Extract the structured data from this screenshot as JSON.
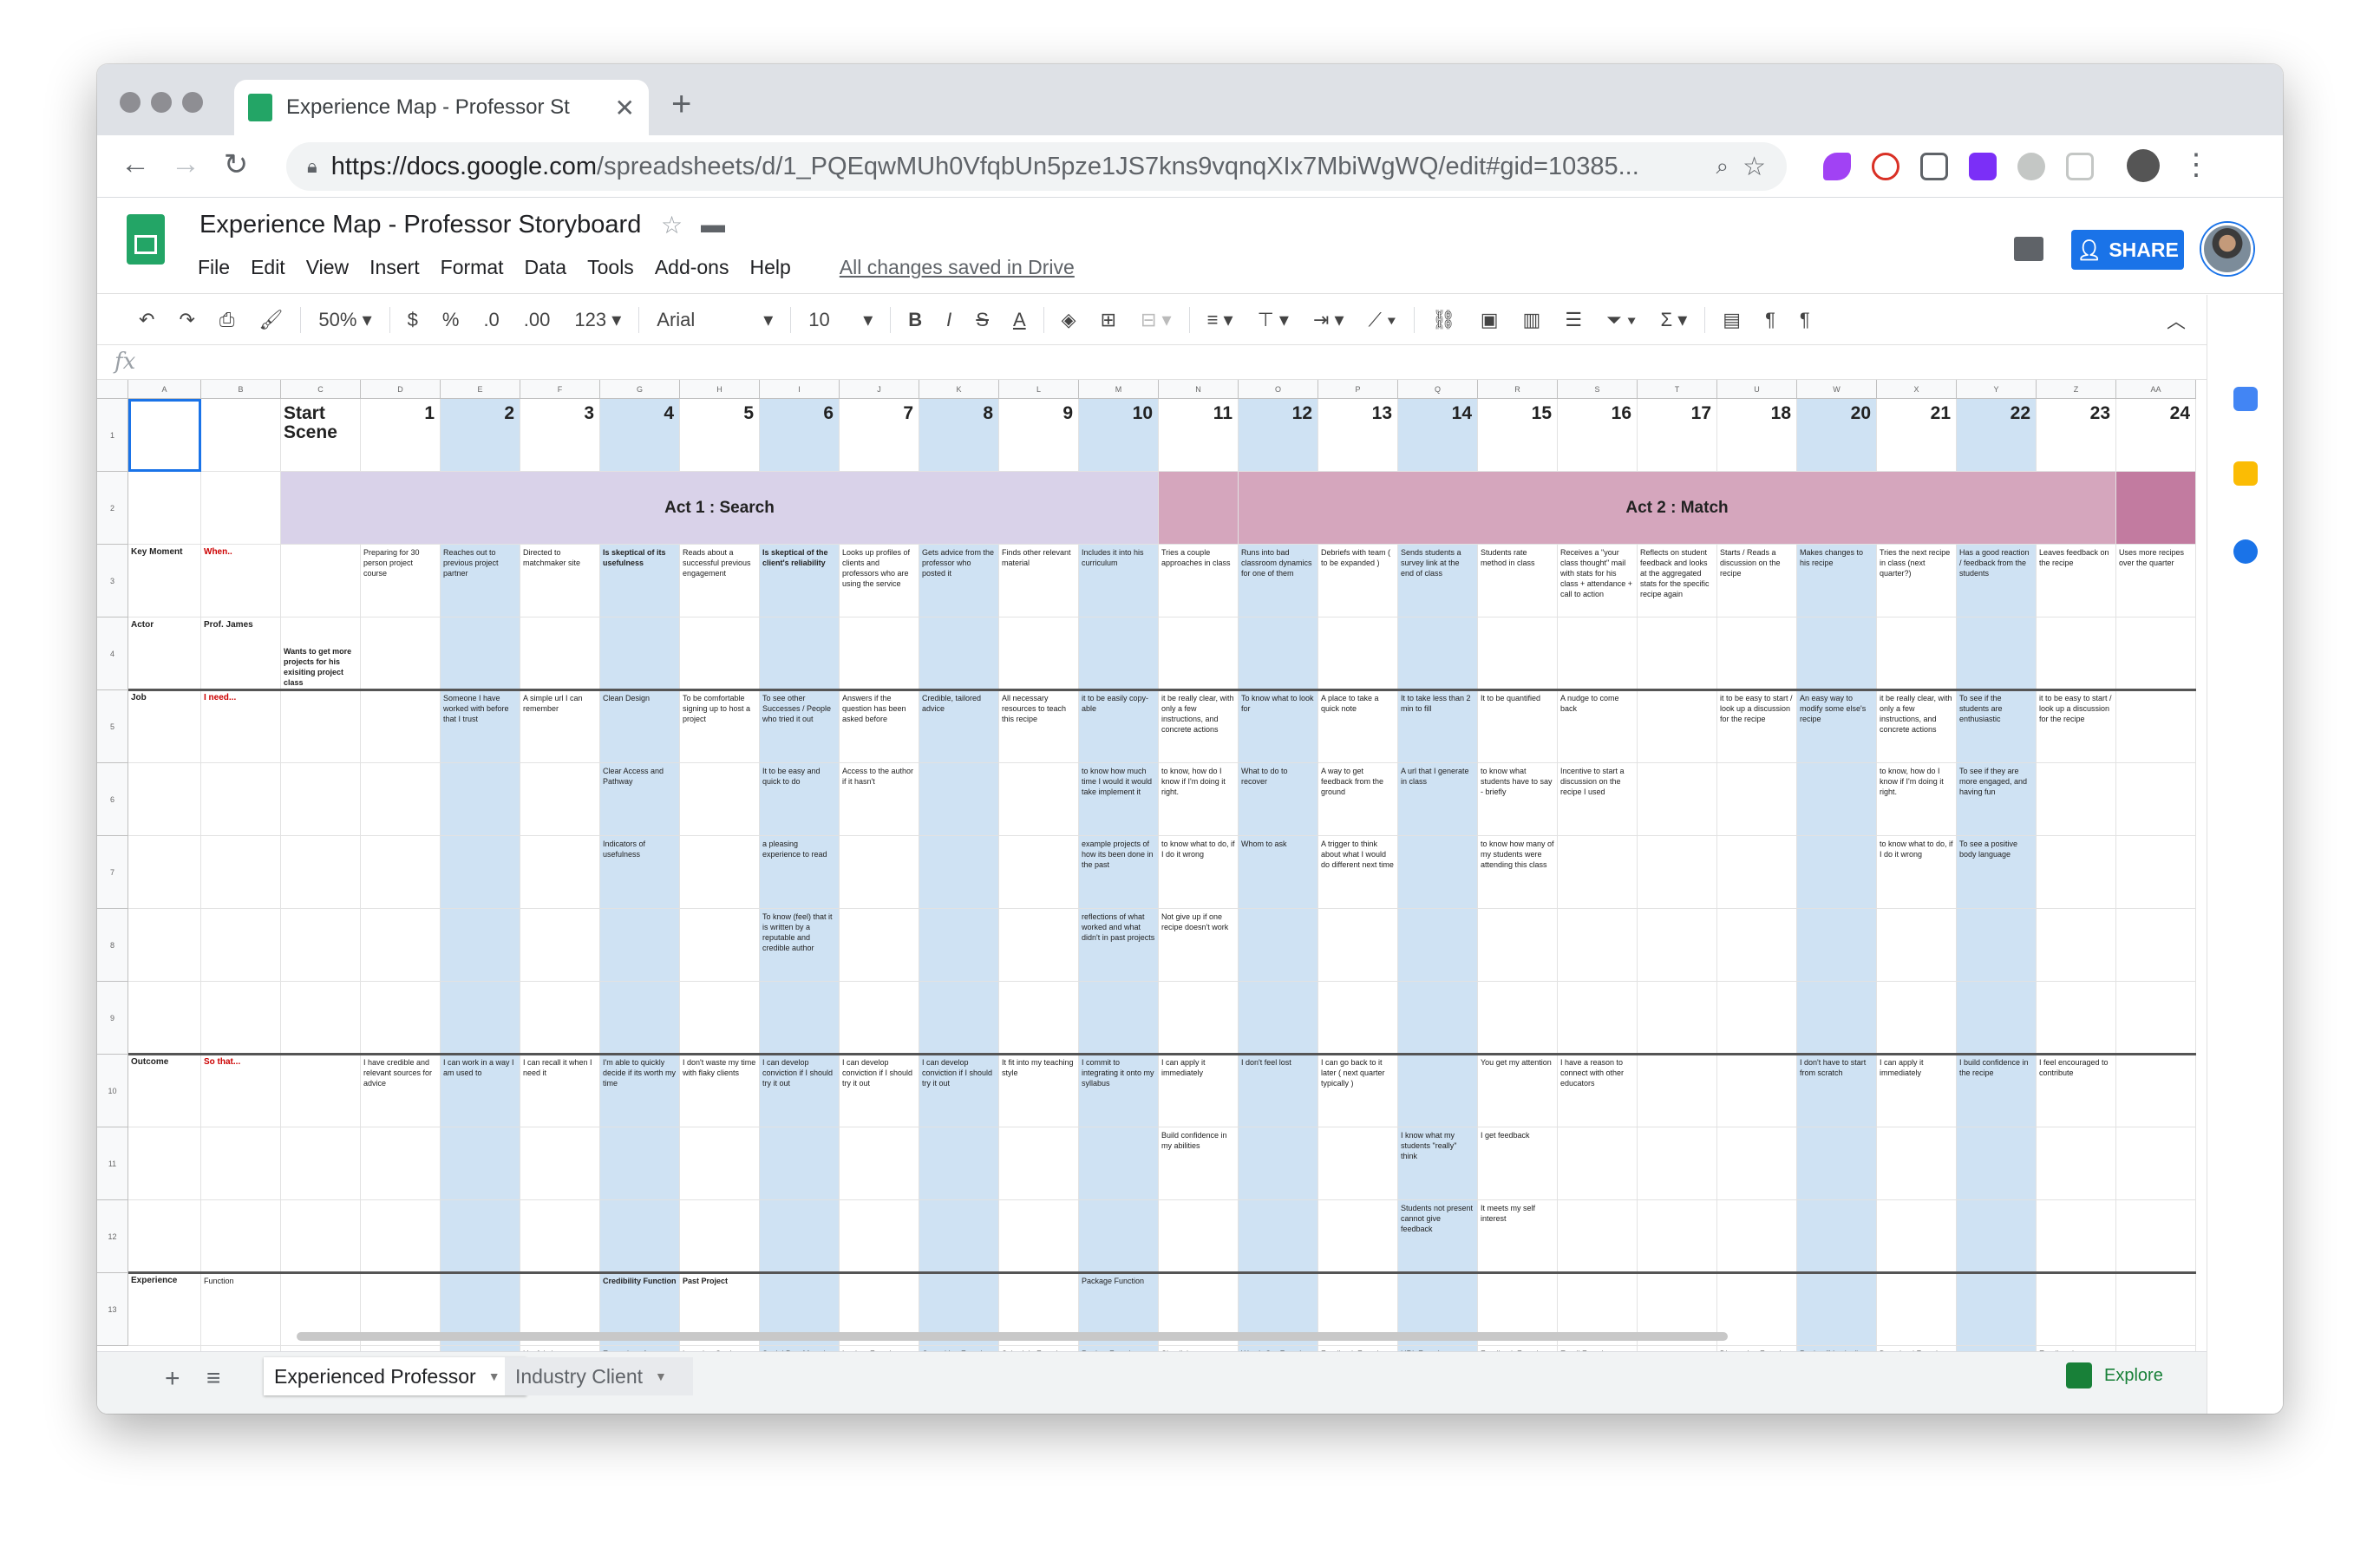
{
  "browser": {
    "tab_title": "Experience Map - Professor St",
    "url_host": "https://docs.google.com",
    "url_rest": "/spreadsheets/d/1_PQEqwMUh0VfqbUn5pze1JS7kns9vqnqXIx7MbiWgWQ/edit#gid=10385..."
  },
  "doc": {
    "title": "Experience Map - Professor Storyboard",
    "menu": [
      "File",
      "Edit",
      "View",
      "Insert",
      "Format",
      "Data",
      "Tools",
      "Add-ons",
      "Help"
    ],
    "saved": "All changes saved in Drive",
    "share": "SHARE"
  },
  "toolbar": {
    "zoom": "50%",
    "currency": "$",
    "percent": "%",
    "dec_less": ".0",
    "dec_more": ".00",
    "format": "123",
    "font": "Arial",
    "size": "10"
  },
  "fx_label": "fx",
  "cols": [
    "A",
    "B",
    "C",
    "D",
    "E",
    "F",
    "G",
    "H",
    "I",
    "J",
    "K",
    "L",
    "M",
    "N",
    "O",
    "P",
    "Q",
    "R",
    "S",
    "T",
    "U",
    "W",
    "X",
    "Y",
    "Z",
    "AA"
  ],
  "rows": [
    "1",
    "2",
    "3",
    "4",
    "5",
    "6",
    "7",
    "8",
    "9",
    "10",
    "11",
    "12",
    "13"
  ],
  "scene_label": "Start Scene",
  "scene_numbers": [
    "1",
    "2",
    "3",
    "4",
    "5",
    "6",
    "7",
    "8",
    "9",
    "10",
    "11",
    "12",
    "13",
    "14",
    "15",
    "16",
    "17",
    "18",
    "20",
    "21",
    "22",
    "23",
    "24"
  ],
  "acts": [
    "Act 1 : Search",
    "Act 2 : Match"
  ],
  "labels": {
    "key_moment": "Key Moment",
    "when": "When..",
    "actor": "Actor",
    "actor_name": "Prof. James",
    "actor_goal": "Wants to get more projects for his exisiting project class",
    "job": "Job",
    "need": "I need...",
    "outcome": "Outcome",
    "so_that": "So that...",
    "experience": "Experience",
    "function": "Function"
  },
  "key_moments": [
    "Preparing for 30 person project course",
    "Reaches out to previous project partner",
    "Directed to matchmaker site",
    "Is skeptical of its usefulness",
    "Reads about a successful previous engagement",
    "Is skeptical of the client's reliability",
    "Looks up profiles of clients and professors who are using the service",
    "Gets advice from the professor who posted it",
    "Finds other relevant material",
    "Includes it into his curriculum",
    "Tries a couple approaches in class",
    "Runs into bad classroom dynamics for one of them",
    "Debriefs with team ( to be expanded )",
    "Sends students a survey link at the end of class",
    "Students rate method in class",
    "Receives a \"your class thought\" mail with stats for his class + attendance + call to action",
    "Reflects on student feedback and looks at the aggregated stats for the specific recipe again",
    "Starts / Reads a discussion on the recipe",
    "Makes changes to his recipe",
    "Tries the next recipe in class (next quarter?)",
    "Has a good reaction / feedback from the students",
    "Leaves feedback on the recipe",
    "Uses more recipes over the quarter"
  ],
  "jobs_r5": [
    "",
    "Someone I have worked with before that I trust",
    "A simple url I can remember",
    "Clean Design",
    "To be comfortable signing up to host a project",
    "To see other Successes / People who tried it out",
    "Answers if the question has been asked before",
    "Credible, tailored advice",
    "All necessary resources to teach this recipe",
    "it to be easily copy-able",
    "it be really clear, with only a few instructions, and concrete actions",
    "To know what to look for",
    "A place to take a quick note",
    "It to take less than 2 min to fill",
    "It to be quantified",
    "A nudge to come back",
    "",
    "it to be easy to start / look up a discussion for the recipe",
    "An easy way to modify some else's recipe",
    "it be really clear, with only a few instructions, and concrete actions",
    "To see if the students are enthusiastic",
    "it to be easy to start / look up a discussion for the recipe",
    ""
  ],
  "jobs_r6": [
    "",
    "",
    "",
    "Clear Access and Pathway",
    "",
    "It to be easy and quick to do",
    "Access to the author if it hasn't",
    "",
    "",
    "to know how much time I would it would take implement it",
    "to know, how do I know if I'm doing it right.",
    "What to do to recover",
    "A way to get feedback from the ground",
    "A url that I generate in class",
    "to know what students have to say - briefly",
    "Incentive to start a discussion on the recipe I used",
    "",
    "",
    "",
    "to know, how do I know if I'm doing it right.",
    "To see if they are more engaged, and having fun",
    "",
    ""
  ],
  "jobs_r7": [
    "",
    "",
    "",
    "Indicators of usefulness",
    "",
    "a pleasing experience to read",
    "",
    "",
    "",
    "example projects of how its been done in the past",
    "to know what to do, if I do it wrong",
    "Whom to ask",
    "A trigger to think about what I would do different next time",
    "",
    "to know how many of my students were attending this class",
    "",
    "",
    "",
    "",
    "to know what to do, if I do it wrong",
    "To see a positive body language",
    "",
    ""
  ],
  "jobs_r8": [
    "",
    "",
    "",
    "",
    "",
    "To know (feel) that it is written by a reputable and credible author",
    "",
    "",
    "",
    "reflections of what worked and what didn't in past projects",
    "Not give up if one recipe doesn't work",
    "",
    "",
    "",
    "",
    "",
    "",
    "",
    "",
    "",
    "",
    "",
    ""
  ],
  "outcomes_r10": [
    "I have credible and relevant sources for advice",
    "I can work in a way I am used to",
    "I can recall it when I need it",
    "I'm able to quickly decide if its worth my time",
    "I don't waste my time with flaky clients",
    "I can develop conviction if I should try it out",
    "I can develop conviction if I should try it out",
    "I can develop conviction if I should try it out",
    "It fit into my teaching style",
    "I commit to integrating it onto my syllabus",
    "I can apply it immediately",
    "I don't feel lost",
    "I can go back to it later ( next quarter typically )",
    "",
    "You get my attention",
    "I have a reason to connect with other educators",
    "",
    "",
    "I don't have to start from scratch",
    "I can apply it immediately",
    "I build confidence in the recipe",
    "I feel encouraged to contribute",
    ""
  ],
  "outcomes_r11": [
    "",
    "",
    "",
    "",
    "",
    "",
    "",
    "",
    "",
    "",
    "Build confidence in my abilities",
    "",
    "",
    "I know what my students \"really\" think",
    "I get feedback",
    "",
    "",
    "",
    "",
    "",
    "",
    "",
    ""
  ],
  "outcomes_r12": [
    "",
    "",
    "",
    "",
    "",
    "",
    "",
    "",
    "",
    "",
    "",
    "",
    "",
    "Students not present cannot give feedback",
    "It meets my self interest",
    "",
    "",
    "",
    "",
    "",
    "",
    "",
    ""
  ],
  "functions_r13": [
    "",
    "",
    "",
    "Credibility Function",
    "Past Project",
    "",
    "",
    "",
    "",
    "Package Function",
    "",
    "",
    "",
    "",
    "",
    "",
    "",
    "",
    "",
    "",
    "",
    "",
    ""
  ],
  "functions_r14": [
    "",
    "",
    "Useful site description and",
    "Examples of previous projects/",
    "Learning Goal",
    "Social Proof function",
    "Lookup Function",
    "Consulting Function",
    "Schedule Function",
    "Review Function",
    "Simplicity",
    "Watch Out Function",
    "Feedback Function",
    "URL Function",
    "Feedback Function",
    "Email Function",
    "",
    "Discussion Function",
    "Recipe \"Version\" Function",
    "Download Function",
    "",
    "Email and Discussion",
    ""
  ],
  "sheets": [
    "Experienced Professor",
    "Industry Client"
  ],
  "explore": "Explore",
  "colors": {
    "blue_col": "#cfe2f3",
    "act1": "#d9d2e9",
    "act1_tail": "#d5a6bd",
    "act2": "#d5a6bd",
    "act3": "#c27ba0",
    "share": "#1a73e8",
    "sheets_green": "#23a566"
  }
}
